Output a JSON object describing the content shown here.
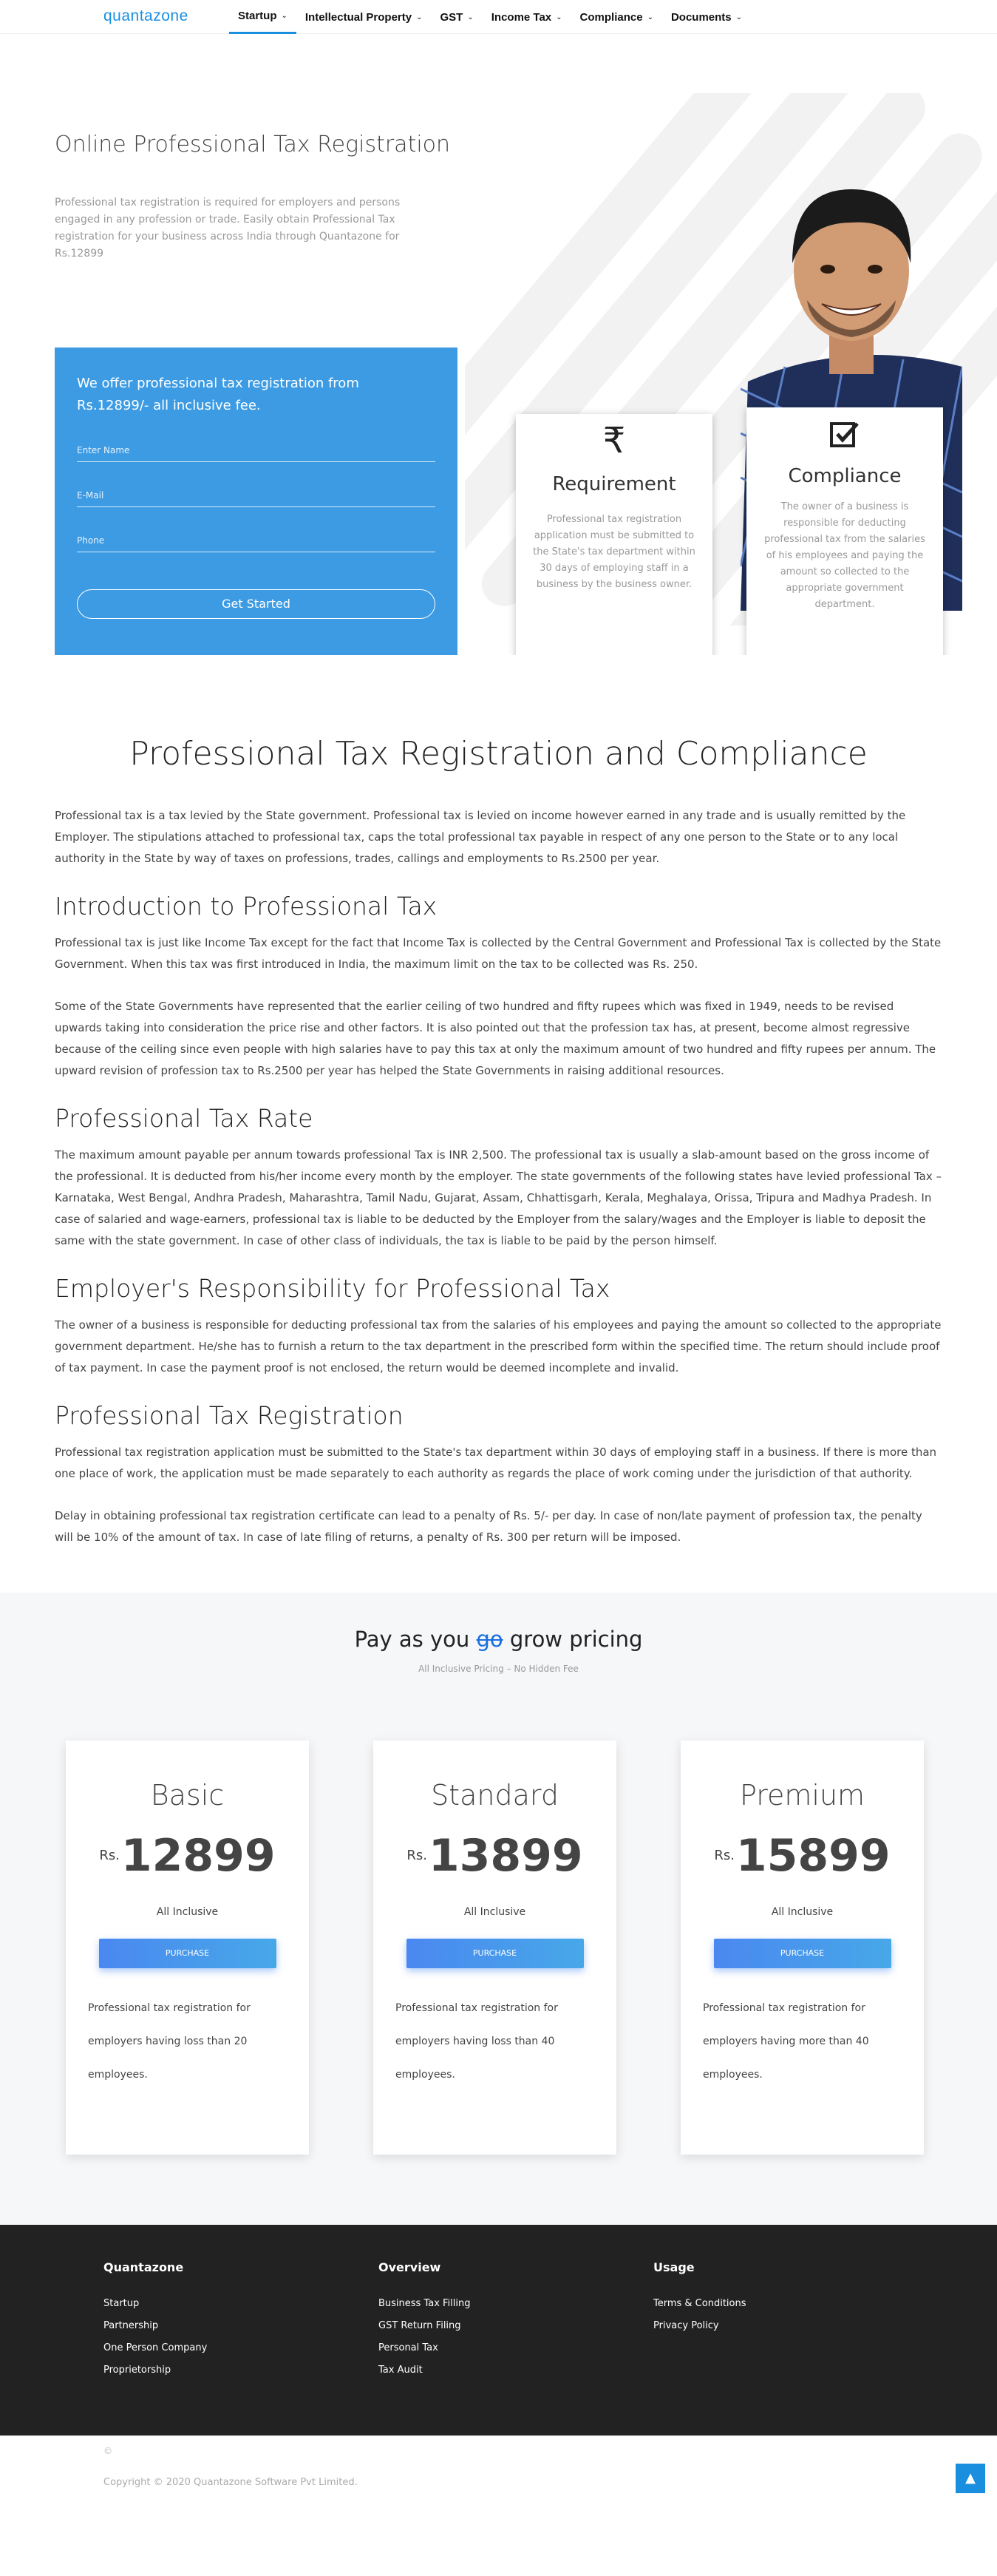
{
  "nav": {
    "logo": "quantazone",
    "items": [
      {
        "label": "Startup"
      },
      {
        "label": "Intellectual Property"
      },
      {
        "label": "GST"
      },
      {
        "label": "Income Tax"
      },
      {
        "label": "Compliance"
      },
      {
        "label": "Documents"
      }
    ],
    "chevron_icon": "chevron-down-icon",
    "active_index": 0,
    "accent_color": "#1a8fe0"
  },
  "hero": {
    "title": "Online Professional Tax Registration",
    "description": "Professional tax registration is required for employers and persons engaged in any profession or trade. Easily obtain Professional Tax registration for your business across India through Quantazone for Rs.12899",
    "offer": {
      "heading": "We offer professional tax registration from Rs.12899/- all inclusive fee.",
      "name_placeholder": "Enter Name",
      "email_placeholder": "E-Mail",
      "phone_placeholder": "Phone",
      "button": "Get Started",
      "color": "#3c9be3"
    },
    "cards": [
      {
        "icon": "rupee-icon",
        "title": "Requirement",
        "text": "Professional tax registration application must be submitted to the State's tax department within 30 days of employing staff in a business by the business owner."
      },
      {
        "icon": "checkbox-icon",
        "title": "Compliance",
        "text": "The owner of a business is responsible for deducting professional tax from the salaries of his employees and paying the amount so collected to the appropriate government department."
      }
    ]
  },
  "article": {
    "title": "Professional Tax Registration and Compliance",
    "intro": "Professional tax is a tax levied by the State government. Professional tax is levied on income however earned in any trade and is usually remitted by the Employer. The stipulations attached to professional tax, caps the total professional tax payable in respect of any one person to the State or to any local authority in the State by way of taxes on professions, trades, callings and employments to Rs.2500 per year.",
    "sections": [
      {
        "heading": "Introduction to Professional Tax",
        "paragraphs": [
          "Professional tax is just like Income Tax except for the fact that Income Tax is collected by the Central Government and Professional Tax is collected by the State Government. When this tax was first introduced in India, the maximum limit on the tax to be collected was Rs. 250.",
          "Some of the State Governments have represented that the earlier ceiling of two hundred and fifty rupees which was fixed in 1949, needs to be revised upwards taking into consideration the price rise and other factors. It is also pointed out that the profession tax has, at present, become almost regressive because of the ceiling since even people with high salaries have to pay this tax at only the maximum amount of two hundred and fifty rupees per annum. The upward revision of profession tax to Rs.2500 per year has helped the State Governments in raising additional resources."
        ]
      },
      {
        "heading": "Professional Tax Rate",
        "paragraphs": [
          "The maximum amount payable per annum towards professional Tax is INR 2,500. The professional tax is usually a slab-amount based on the gross income of the professional. It is deducted from his/her income every month by the employer. The state governments of the following states have levied professional Tax – Karnataka, West Bengal, Andhra Pradesh, Maharashtra, Tamil Nadu, Gujarat, Assam, Chhattisgarh, Kerala, Meghalaya, Orissa, Tripura and Madhya Pradesh. In case of salaried and wage-earners, professional tax is liable to be deducted by the Employer from the salary/wages and the Employer is liable to deposit the same with the state government. In case of other class of individuals, the tax is liable to be paid by the person himself."
        ]
      },
      {
        "heading": "Employer's Responsibility for Professional Tax",
        "paragraphs": [
          "The owner of a business is responsible for deducting professional tax from the salaries of his employees and paying the amount so collected to the appropriate government department. He/she has to furnish a return to the tax department in the prescribed form within the specified time. The return should include proof of tax payment. In case the payment proof is not enclosed, the return would be deemed incomplete and invalid."
        ]
      },
      {
        "heading": "Professional Tax Registration",
        "paragraphs": [
          "Professional tax registration application must be submitted to the State's tax department within 30 days of employing staff in a business. If there is more than one place of work, the application must be made separately to each authority as regards the place of work coming under the jurisdiction of that authority.",
          "Delay in obtaining professional tax registration certificate can lead to a penalty of Rs. 5/- per day. In case of non/late payment of profession tax, the penalty will be 10% of the amount of tax. In case of late filing of returns, a penalty of Rs. 300 per return will be imposed."
        ]
      }
    ]
  },
  "pricing": {
    "title_pre": "Pay as you ",
    "title_strike": "go",
    "title_post": " grow pricing",
    "subtitle": "All Inclusive Pricing – No Hidden Fee",
    "plans": [
      {
        "name": "Basic",
        "currency": "Rs.",
        "price": "12899",
        "inclusive": "All Inclusive",
        "button": "PURCHASE",
        "desc": "Professional tax registration for employers having loss than 20 employees."
      },
      {
        "name": "Standard",
        "currency": "Rs.",
        "price": "13899",
        "inclusive": "All Inclusive",
        "button": "PURCHASE",
        "desc": "Professional tax registration for employers having loss than 40 employees."
      },
      {
        "name": "Premium",
        "currency": "Rs.",
        "price": "15899",
        "inclusive": "All Inclusive",
        "button": "PURCHASE",
        "desc": "Professional tax registration for employers having more than 40 employees."
      }
    ]
  },
  "footer": {
    "columns": [
      {
        "heading": "Quantazone",
        "items": [
          "Startup",
          "Partnership",
          "One Person Company",
          "Proprietorship"
        ]
      },
      {
        "heading": "Overview",
        "items": [
          "Business Tax Filling",
          "GST Return Filing",
          "Personal Tax",
          "Tax Audit"
        ]
      },
      {
        "heading": "Usage",
        "items": [
          "Terms & Conditions",
          "Privacy Policy"
        ]
      }
    ],
    "symbol": "©",
    "copyright": "Copyright © 2020 Quantazone Software Pvt Limited.",
    "back_to_top_icon": "arrow-up-icon"
  }
}
